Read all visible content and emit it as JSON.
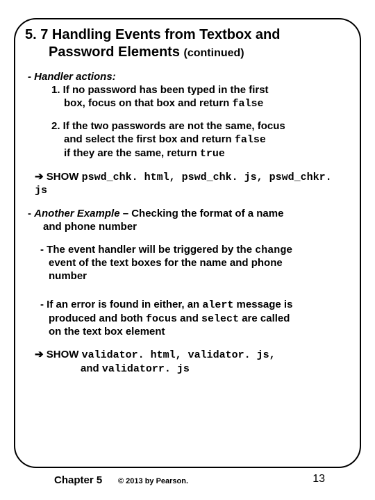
{
  "title": {
    "line1": "5. 7 Handling Events from Textbox and",
    "line2": "Password Elements",
    "continued": "(continued)"
  },
  "sec1": {
    "heading": "- Handler actions:",
    "item1_l1": "1. If no password has been typed in the first",
    "item1_l2": "box, focus on that box and return ",
    "item1_code": "false",
    "item2_l1": "2. If the two passwords are not the same, focus",
    "item2_l2": "and select the first box and return ",
    "item2_code1": "false",
    "item2_l3": "if they are the same, return ",
    "item2_code2": "true"
  },
  "show1": {
    "arrow": "➔",
    "label": " SHOW ",
    "files": "pswd_chk. html, pswd_chk. js, pswd_chkr. js"
  },
  "sec2": {
    "lead_dash": "- ",
    "lead_em": "Another Example",
    "lead_rest": " – Checking the format of a name",
    "lead_l2": "and phone number",
    "p1_l1a": "- The event handler will be triggered by the ",
    "p1_code": "change",
    "p1_l2": "event of the text boxes for the name and phone",
    "p1_l3": "number",
    "p2_l1a": "- If an error is found in either, an ",
    "p2_code1": "alert",
    "p2_l1b": " message is",
    "p2_l2a": "produced and both ",
    "p2_code2": "focus",
    "p2_l2b": " and ",
    "p2_code3": "select",
    "p2_l2c": " are called",
    "p2_l3": "on the text box element"
  },
  "show2": {
    "arrow": "➔",
    "label": " SHOW ",
    "files1": "validator. html, validator. js,",
    "and": "and ",
    "files2": "validatorr. js"
  },
  "footer": {
    "chapter": "Chapter 5",
    "copyright": "© 2013 by Pearson.",
    "page": "13"
  }
}
